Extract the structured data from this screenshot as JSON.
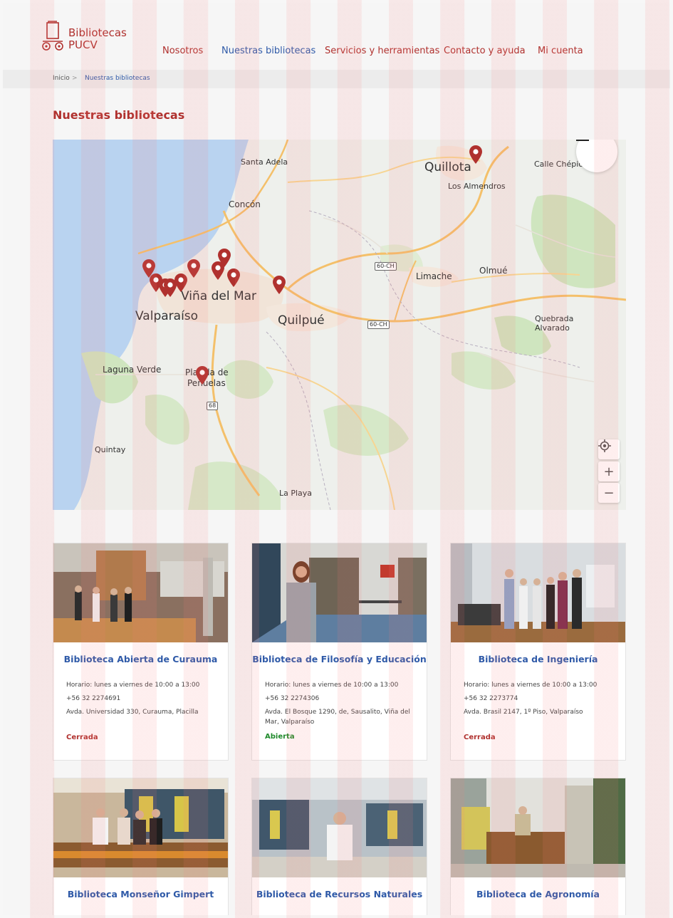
{
  "header": {
    "logo_line1": "Bibliotecas",
    "logo_line2": "PUCV",
    "nav": [
      "Nosotros",
      "Nuestras bibliotecas",
      "Servicios y herramientas",
      "Contacto y ayuda",
      "Mi cuenta"
    ],
    "active_nav": "Nuestras bibliotecas"
  },
  "breadcrumb": {
    "home": "Inicio",
    "separator": ">",
    "current": "Nuestras bibliotecas"
  },
  "page_title": "Nuestras bibliotecas",
  "map": {
    "places": {
      "santa_adela": "Santa Adela",
      "quillota": "Quillota",
      "los_almendros": "Los Almendros",
      "calle_chepica": "Calle Chépica",
      "concon": "Concón",
      "limache": "Limache",
      "olmue": "Olmué",
      "vina": "Viña del Mar",
      "valparaiso": "Valparaíso",
      "quilpue": "Quilpué",
      "quebrada_alvarado_1": "Quebrada",
      "quebrada_alvarado_2": "Alvarado",
      "laguna_verde": "Laguna Verde",
      "placilla_1": "Placilla de",
      "placilla_2": "Peñuelas",
      "quintay": "Quintay",
      "la_playa": "La Playa"
    },
    "routes": {
      "r1": "60-CH",
      "r2": "60-CH",
      "r3": "68"
    },
    "controls": {
      "zoom_in": "+",
      "zoom_out": "−"
    }
  },
  "libraries": [
    {
      "name": "Biblioteca Abierta de Curauma",
      "hours": "Horario: lunes a viernes de 10:00 a 13:00",
      "phone": "+56 32 2274691",
      "address": "Avda. Universidad 330, Curauma, Placilla",
      "status": "Cerrada"
    },
    {
      "name": "Biblioteca de Filosofía y Educación",
      "hours": "Horario: lunes a viernes de 10:00 a 13:00",
      "phone": "+56 32 2274306",
      "address": "Avda. El Bosque 1290, de, Sausalito, Viña del Mar, Valparaíso",
      "status": "Abierta"
    },
    {
      "name": "Biblioteca de Ingeniería",
      "hours": "Horario: lunes a viernes de 10:00 a 13:00",
      "phone": "+56 32 2273774",
      "address": "Avda. Brasil 2147, 1º Piso, Valparaíso",
      "status": "Cerrada"
    },
    {
      "name": "Biblioteca Monseñor Gimpert"
    },
    {
      "name": "Biblioteca de Recursos Naturales"
    },
    {
      "name": "Biblioteca de Agronomía"
    }
  ],
  "colors": {
    "brand_red": "#b0312e",
    "link_blue": "#2f5aa8",
    "open_green": "#1f8a2b"
  }
}
